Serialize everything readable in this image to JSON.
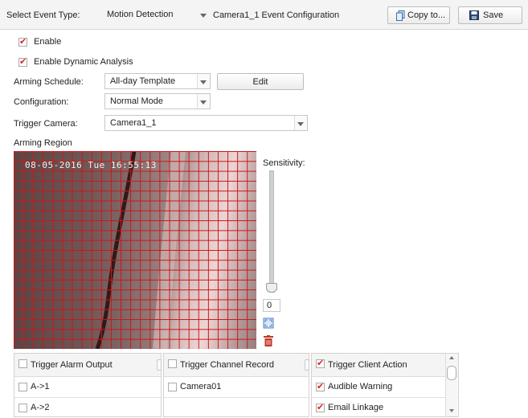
{
  "topbar": {
    "event_type_label": "Select Event Type:",
    "event_type_value": "Motion Detection",
    "config_title": "Camera1_1 Event Configuration",
    "copy_label": "Copy to...",
    "save_label": "Save"
  },
  "enable": {
    "label": "Enable",
    "checked": true
  },
  "dynamic_analysis": {
    "label": "Enable Dynamic Analysis",
    "checked": true
  },
  "arming_schedule": {
    "label": "Arming Schedule:",
    "value": "All-day Template",
    "edit_label": "Edit"
  },
  "configuration": {
    "label": "Configuration:",
    "value": "Normal Mode"
  },
  "trigger_camera": {
    "label": "Trigger Camera:",
    "value": "Camera1_1"
  },
  "arming_region": {
    "label": "Arming Region",
    "osd_text": "08-05-2016 Tue 16:55:13"
  },
  "sensitivity": {
    "label": "Sensitivity:",
    "value": "0"
  },
  "alarm_output": {
    "header": "Trigger Alarm Output",
    "items": [
      "A->1",
      "A->2"
    ]
  },
  "channel_record": {
    "header": "Trigger Channel Record",
    "items": [
      "Camera01"
    ]
  },
  "client_action": {
    "header": "Trigger Client Action",
    "items": [
      "Audible Warning",
      "Email Linkage"
    ]
  }
}
